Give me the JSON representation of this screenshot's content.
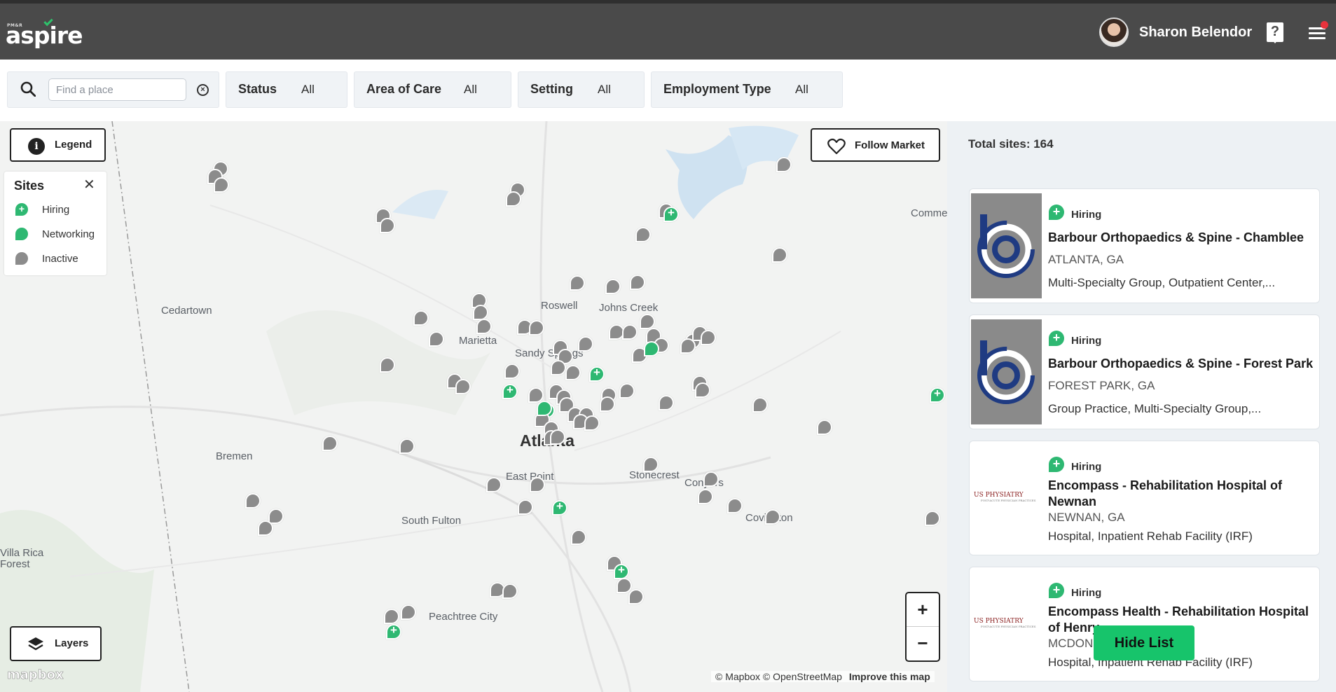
{
  "header": {
    "logo_top": "PM&R",
    "logo_word": "aspire",
    "user_name": "Sharon Belendor",
    "help_label": "?"
  },
  "filters": {
    "search_placeholder": "Find a place",
    "search_value": "",
    "items": [
      {
        "label": "Status",
        "value": "All"
      },
      {
        "label": "Area of Care",
        "value": "All"
      },
      {
        "label": "Setting",
        "value": "All"
      },
      {
        "label": "Employment Type",
        "value": "All"
      }
    ]
  },
  "map": {
    "legend_label": "Legend",
    "follow_label": "Follow Market",
    "layers_label": "Layers",
    "zoom_in": "+",
    "zoom_out": "−",
    "mapbox_label": "mapbox",
    "attribution": "© Mapbox © OpenStreetMap",
    "improve_label": "Improve this map",
    "sites_panel": {
      "title": "Sites",
      "close": "✕",
      "items": [
        {
          "label": "Hiring",
          "color": "#2eb872"
        },
        {
          "label": "Networking",
          "color": "#2eb872"
        },
        {
          "label": "Inactive",
          "color": "#8c8c8c"
        }
      ]
    },
    "places": [
      "Cedartown",
      "Bremen",
      "Marietta",
      "Sandy Springs",
      "Roswell",
      "Johns Creek",
      "Atlanta",
      "East Point",
      "South Fulton",
      "Stonecrest",
      "Conyers",
      "Covington",
      "Peachtree City",
      "Commerce",
      "Villa Rica",
      "Forest"
    ]
  },
  "sidebar": {
    "total_label": "Total sites: 164",
    "hide_list": "Hide List",
    "cards": [
      {
        "status": "Hiring",
        "name": "Barbour Orthopaedics & Spine - Chamblee",
        "location": "ATLANTA, GA",
        "types": "Multi-Specialty Group, Outpatient Center,...",
        "logo": "barbour"
      },
      {
        "status": "Hiring",
        "name": "Barbour Orthopaedics & Spine - Forest Park",
        "location": "FOREST PARK, GA",
        "types": "Group Practice, Multi-Specialty Group,...",
        "logo": "barbour"
      },
      {
        "status": "Hiring",
        "name": "Encompass - Rehabilitation Hospital of Newnan",
        "location": "NEWNAN, GA",
        "types": "Hospital, Inpatient Rehab Facility (IRF)",
        "logo": "usphysiatry"
      },
      {
        "status": "Hiring",
        "name": "Encompass Health - Rehabilitation Hospital of Henry",
        "location": "MCDONOUGH, GA",
        "types": "Hospital, Inpatient Rehab Facility (IRF)",
        "logo": "usphysiatry"
      }
    ],
    "usp_logo_text": "US PHYSIATRY",
    "usp_logo_sub": "POST-ACUTE PHYSICIAN PRACTICES"
  }
}
